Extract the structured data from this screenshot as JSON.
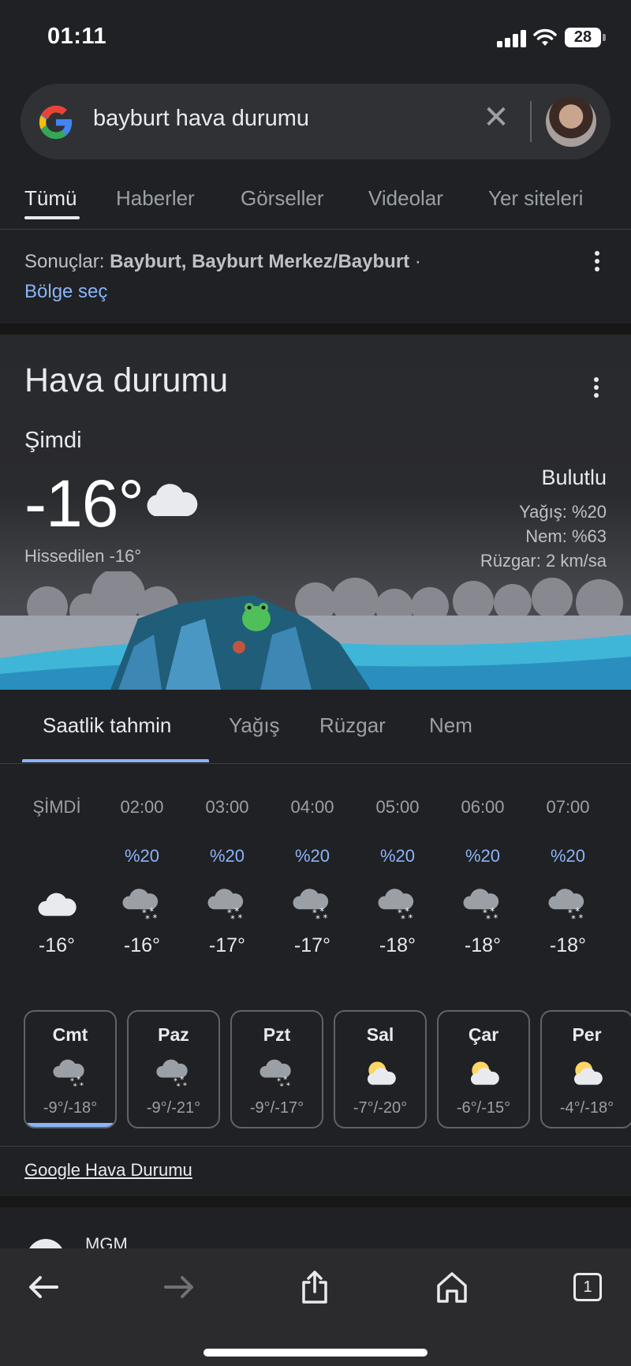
{
  "status": {
    "time": "01:11",
    "battery": "28"
  },
  "search": {
    "query": "bayburt hava durumu"
  },
  "tabs": [
    "Tümü",
    "Haberler",
    "Görseller",
    "Videolar",
    "Yer siteleri"
  ],
  "results": {
    "prefix": "Sonuçlar: ",
    "location": "Bayburt, Bayburt Merkez/Bayburt",
    "suffix": " · ",
    "region_link": "Bölge seç"
  },
  "weather": {
    "title": "Hava durumu",
    "now_label": "Şimdi",
    "temp": "-16°",
    "feels_like": "Hissedilen -16°",
    "condition": "Bulutlu",
    "precip": "Yağış: %20",
    "humidity": "Nem: %63",
    "wind": "Rüzgar: 2 km/sa"
  },
  "subtabs": [
    "Saatlik tahmin",
    "Yağış",
    "Rüzgar",
    "Nem"
  ],
  "hourly": [
    {
      "time": "ŞİMDİ",
      "precip": "",
      "icon": "cloud-icon",
      "temp": "-16°"
    },
    {
      "time": "02:00",
      "precip": "%20",
      "icon": "snow-cloud-icon",
      "temp": "-16°"
    },
    {
      "time": "03:00",
      "precip": "%20",
      "icon": "snow-cloud-icon",
      "temp": "-17°"
    },
    {
      "time": "04:00",
      "precip": "%20",
      "icon": "snow-cloud-icon",
      "temp": "-17°"
    },
    {
      "time": "05:00",
      "precip": "%20",
      "icon": "snow-cloud-icon",
      "temp": "-18°"
    },
    {
      "time": "06:00",
      "precip": "%20",
      "icon": "snow-cloud-icon",
      "temp": "-18°"
    },
    {
      "time": "07:00",
      "precip": "%20",
      "icon": "snow-cloud-icon",
      "temp": "-18°"
    }
  ],
  "daily": [
    {
      "day": "Cmt",
      "icon": "snow-cloud-icon",
      "range": "-9°/-18°",
      "selected": true
    },
    {
      "day": "Paz",
      "icon": "snow-cloud-icon",
      "range": "-9°/-21°"
    },
    {
      "day": "Pzt",
      "icon": "snow-cloud-icon",
      "range": "-9°/-17°"
    },
    {
      "day": "Sal",
      "icon": "partly-sunny-icon",
      "range": "-7°/-20°"
    },
    {
      "day": "Çar",
      "icon": "partly-sunny-icon",
      "range": "-6°/-15°"
    },
    {
      "day": "Per",
      "icon": "partly-sunny-icon",
      "range": "-4°/-18°"
    }
  ],
  "source_link": "Google Hava Durumu",
  "next_result": "MGM",
  "tab_count": "1",
  "colors": {
    "accent": "#8ab4f8",
    "background": "#202124",
    "surface": "#303134"
  }
}
